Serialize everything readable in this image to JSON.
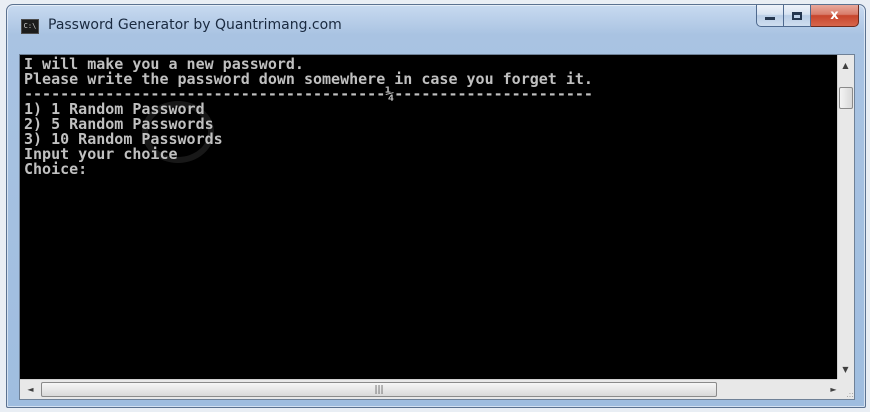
{
  "window": {
    "title": "Password Generator by Quantrimang.com",
    "icon": "console-app-icon",
    "icon_glyph": "C:\\",
    "buttons": {
      "minimize": "minimize-icon",
      "maximize": "maximize-icon",
      "close": "x"
    }
  },
  "console": {
    "lines": [
      "I will make you a new password.",
      "Please write the password down somewhere in case you forget it.",
      "----------------------------------------¼----------------------",
      "1) 1 Random Password",
      "2) 5 Random Passwords",
      "3) 10 Random Passwords",
      "Input your choice",
      "Choice:"
    ],
    "text_color": "#c0c0c0",
    "background": "#000000"
  },
  "scrollbars": {
    "up_arrow": "▲",
    "down_arrow": "▼",
    "left_arrow": "◄",
    "right_arrow": "►",
    "h_thumb_grip": "|||",
    "size_grip": ".::"
  }
}
